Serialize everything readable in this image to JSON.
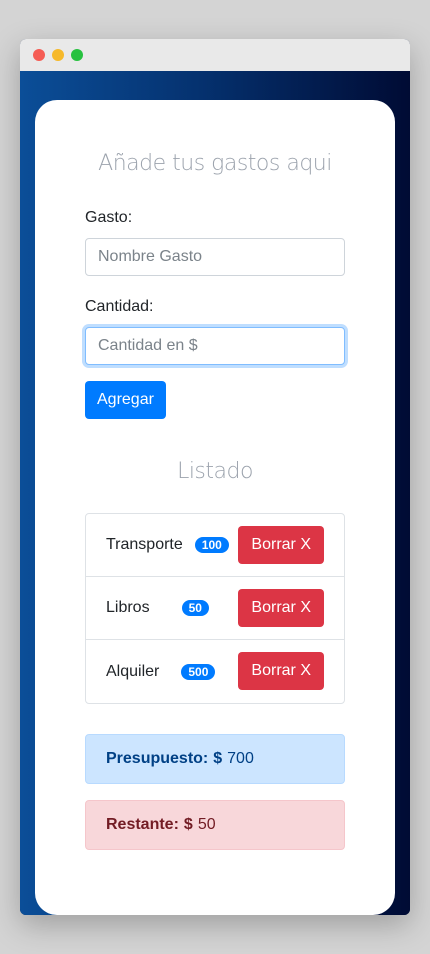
{
  "form": {
    "title": "Añade tus gastos aqui",
    "gasto_label": "Gasto:",
    "gasto_placeholder": "Nombre Gasto",
    "cantidad_label": "Cantidad:",
    "cantidad_placeholder": "Cantidad en $",
    "submit_label": "Agregar"
  },
  "listado": {
    "title": "Listado",
    "delete_label": "Borrar X",
    "items": [
      {
        "name": "Transporte",
        "amount": "100"
      },
      {
        "name": "Libros",
        "amount": "50"
      },
      {
        "name": "Alquiler",
        "amount": "500"
      }
    ]
  },
  "presupuesto": {
    "label": "Presupuesto:",
    "currency": "$",
    "value": "700"
  },
  "restante": {
    "label": "Restante:",
    "currency": "$",
    "value": "50"
  },
  "colors": {
    "primary": "#007bff",
    "danger": "#dc3545",
    "alert_primary_bg": "#cce5ff",
    "alert_danger_bg": "#f8d7da"
  }
}
